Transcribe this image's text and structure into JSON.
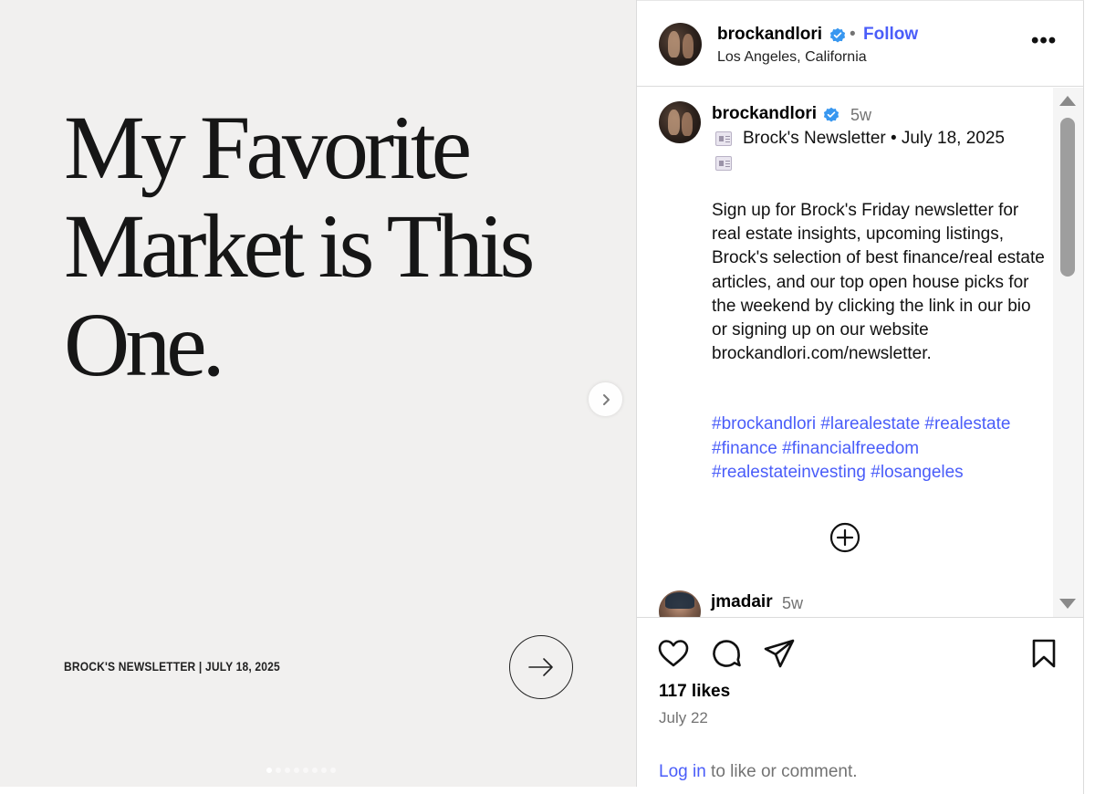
{
  "post_media": {
    "headline_lines": [
      "My Favorite",
      "Market is This",
      "One."
    ],
    "footer_text": "BROCK'S NEWSLETTER | JULY 18, 2025",
    "carousel": {
      "total": 8,
      "active_index": 0
    },
    "next_icon": "chevron-right-icon",
    "arrow_icon": "arrow-right-circle-icon"
  },
  "header": {
    "username": "brockandlori",
    "separator": "•",
    "follow_label": "Follow",
    "location": "Los Angeles, California",
    "more_label": "•••"
  },
  "caption_comment": {
    "username": "brockandlori",
    "time": "5w",
    "newsletter_line": "Brock's Newsletter • July 18, 2025",
    "body": "Sign up for Brock's Friday newsletter for real estate insights, upcoming listings, Brock's selection of best finance/real estate articles, and our top open house picks for the weekend by clicking the link in our bio or signing up on our website brockandlori.com/newsletter.",
    "hashtags": "#brockandlori #larealestate #realestate #finance #financialfreedom #realestateinvesting #losangeles"
  },
  "comment2": {
    "username": "jmadair",
    "time": "5w"
  },
  "actions": {
    "likes": "117 likes",
    "date": "July 22",
    "login_link": "Log in",
    "login_rest": " to like or comment.",
    "icons": [
      "heart-icon",
      "comment-icon",
      "share-icon",
      "bookmark-icon"
    ]
  },
  "colors": {
    "accent": "#4a5df9",
    "verified": "#3897f0",
    "media_bg": "#f1f0ef",
    "muted_text": "#737373"
  }
}
